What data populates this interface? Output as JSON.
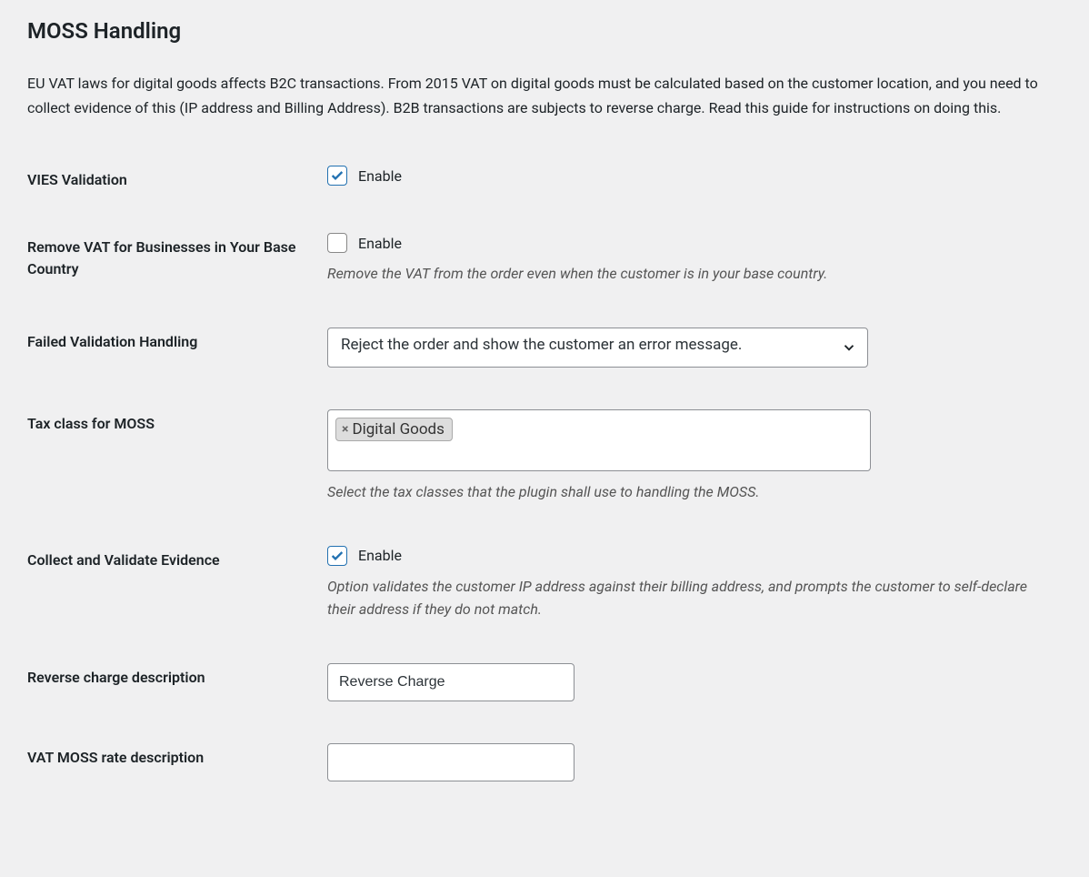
{
  "section": {
    "title": "MOSS Handling",
    "description": "EU VAT laws for digital goods affects B2C transactions. From 2015 VAT on digital goods must be calculated based on the customer location, and you need to collect evidence of this (IP address and Billing Address). B2B transactions are subjects to reverse charge. Read this guide for instructions on doing this."
  },
  "fields": {
    "vies_validation": {
      "label": "VIES Validation",
      "checkbox_label": "Enable",
      "checked": true
    },
    "remove_vat_base_country": {
      "label": "Remove VAT for Businesses in Your Base Country",
      "checkbox_label": "Enable",
      "checked": false,
      "help": "Remove the VAT from the order even when the customer is in your base country."
    },
    "failed_validation": {
      "label": "Failed Validation Handling",
      "selected": "Reject the order and show the customer an error message."
    },
    "tax_class_moss": {
      "label": "Tax class for MOSS",
      "tags": [
        "Digital Goods"
      ],
      "help": "Select the tax classes that the plugin shall use to handling the MOSS."
    },
    "collect_validate_evidence": {
      "label": "Collect and Validate Evidence",
      "checkbox_label": "Enable",
      "checked": true,
      "help": "Option validates the customer IP address against their billing address, and prompts the customer to self-declare their address if they do not match."
    },
    "reverse_charge_desc": {
      "label": "Reverse charge description",
      "value": "Reverse Charge"
    },
    "vat_moss_rate_desc": {
      "label": "VAT MOSS rate description",
      "value": ""
    }
  }
}
